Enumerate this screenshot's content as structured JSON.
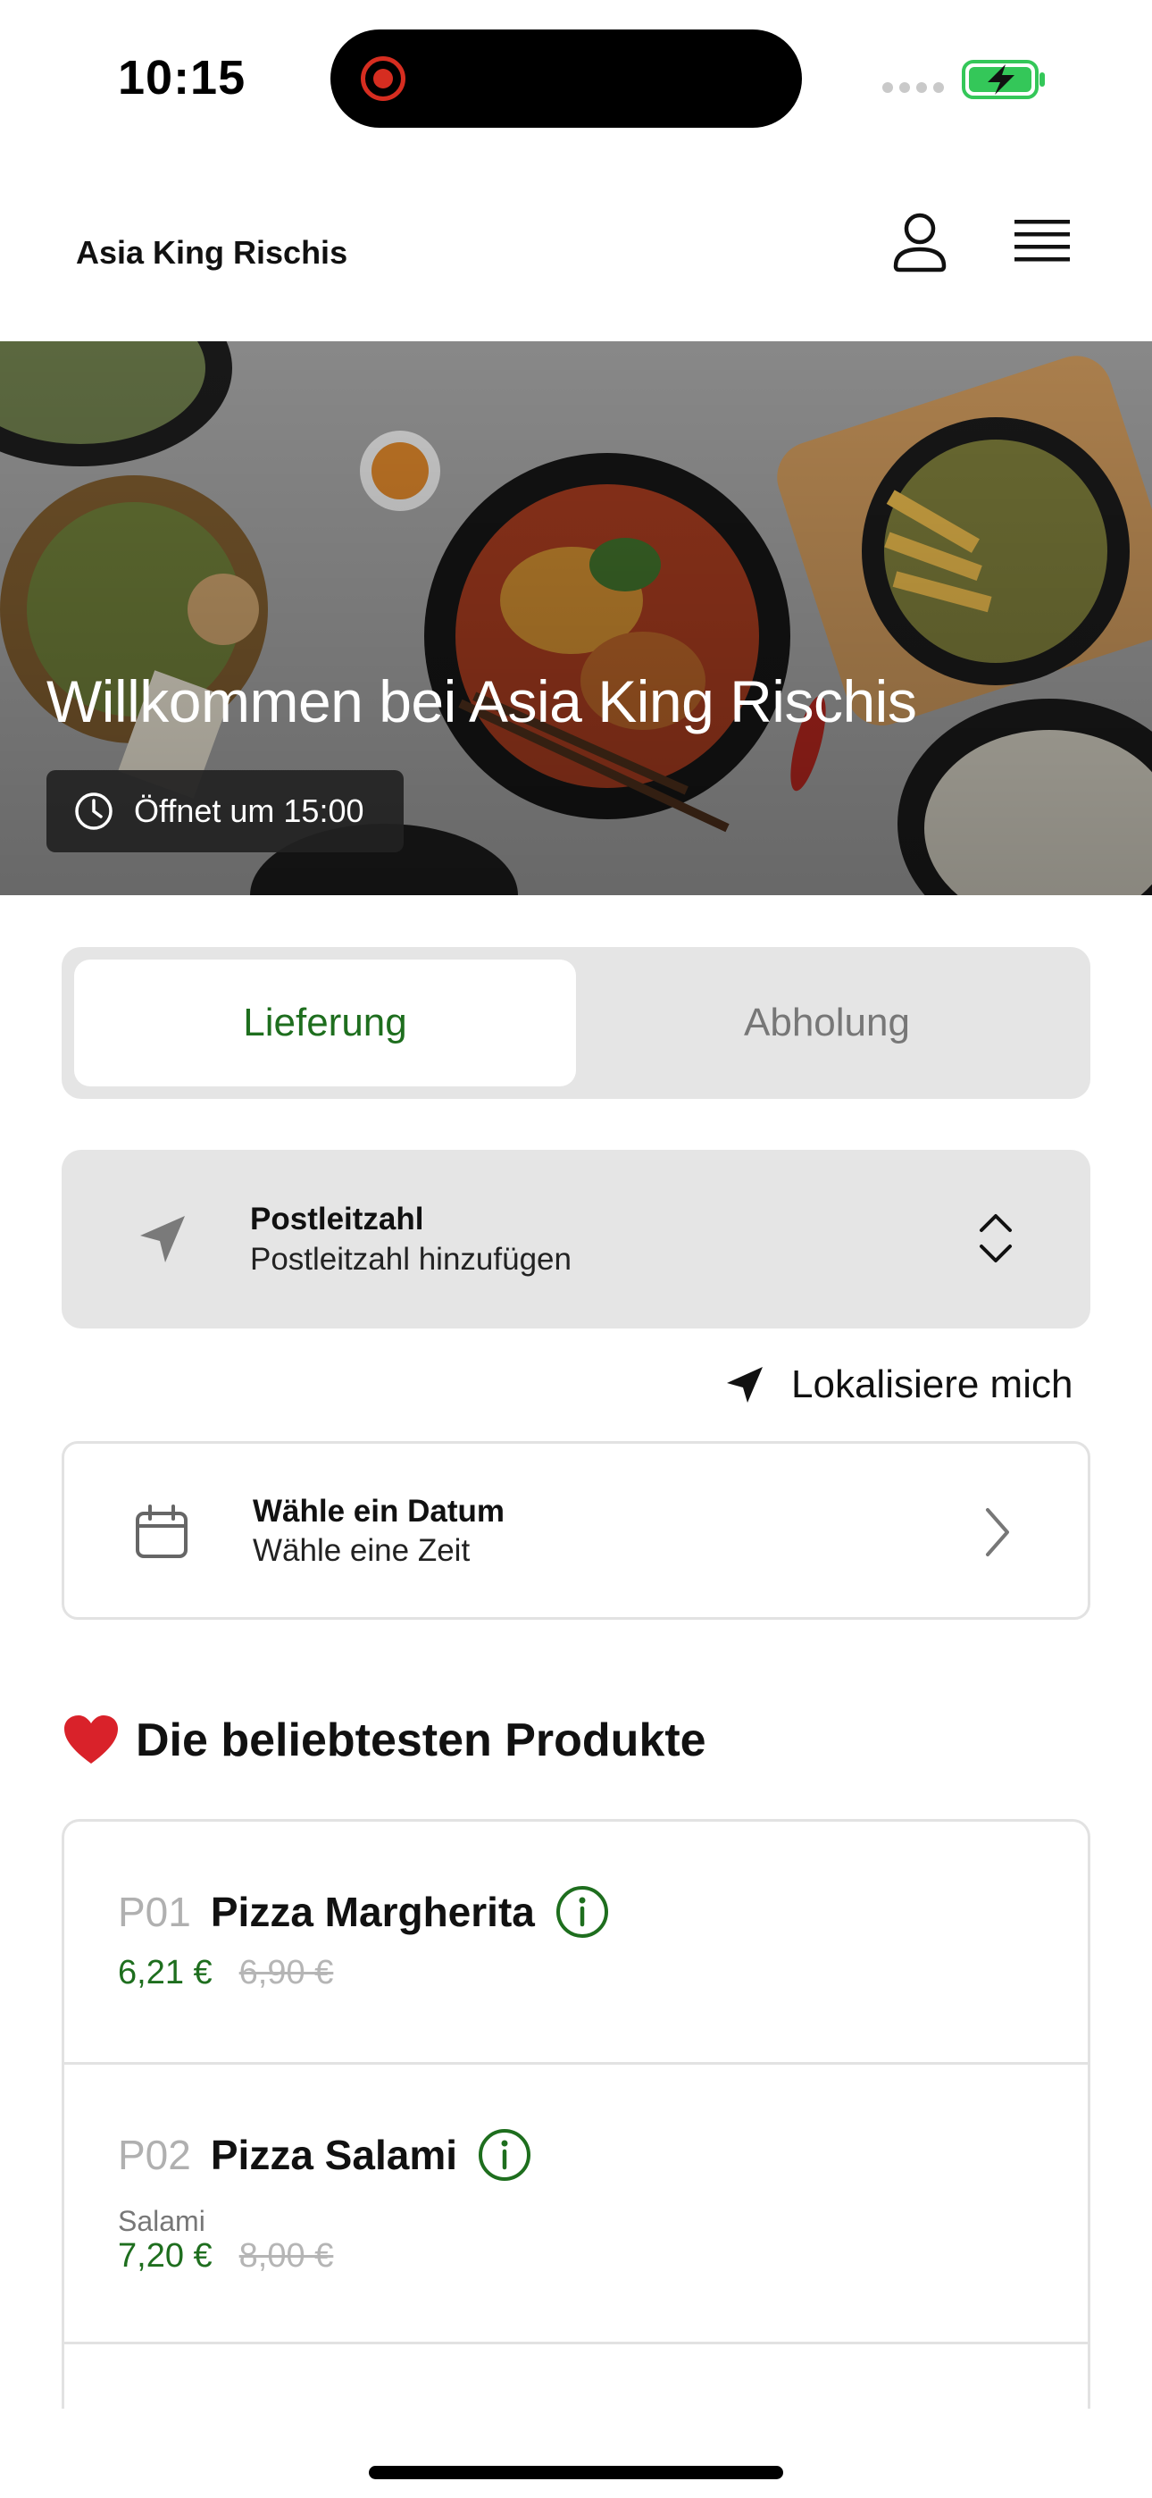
{
  "status_bar": {
    "time": "10:15"
  },
  "header": {
    "brand": "Asia King Rischis"
  },
  "hero": {
    "title": "Willkommen bei Asia King Rischis",
    "hours": "Öffnet um 15:00"
  },
  "order_type": {
    "options": [
      "Lieferung",
      "Abholung"
    ],
    "selected": "Lieferung"
  },
  "postal": {
    "label": "Postleitzahl",
    "placeholder": "Postleitzahl hinzufügen"
  },
  "locate": {
    "label": "Lokalisiere mich"
  },
  "date": {
    "label": "Wähle ein Datum",
    "hint": "Wähle eine Zeit"
  },
  "popular": {
    "title": "Die beliebtesten Produkte",
    "items": [
      {
        "code": "P01",
        "name": "Pizza Margherita",
        "description": "",
        "price": "6,21 €",
        "old_price": "6,90 €"
      },
      {
        "code": "P02",
        "name": "Pizza Salami",
        "description": "Salami",
        "price": "7,20 €",
        "old_price": "8,00 €"
      }
    ]
  },
  "colors": {
    "accent_green": "#1e6e1e",
    "panel_gray": "#e5e5e5",
    "record_red": "#d62d20",
    "battery_green": "#34c759"
  },
  "icons": [
    "record-icon",
    "battery-icon",
    "user-icon",
    "menu-icon",
    "clock-icon",
    "navigation-arrow-icon",
    "chevron-updown-icon",
    "calendar-icon",
    "chevron-right-icon",
    "heart-icon",
    "info-icon"
  ]
}
